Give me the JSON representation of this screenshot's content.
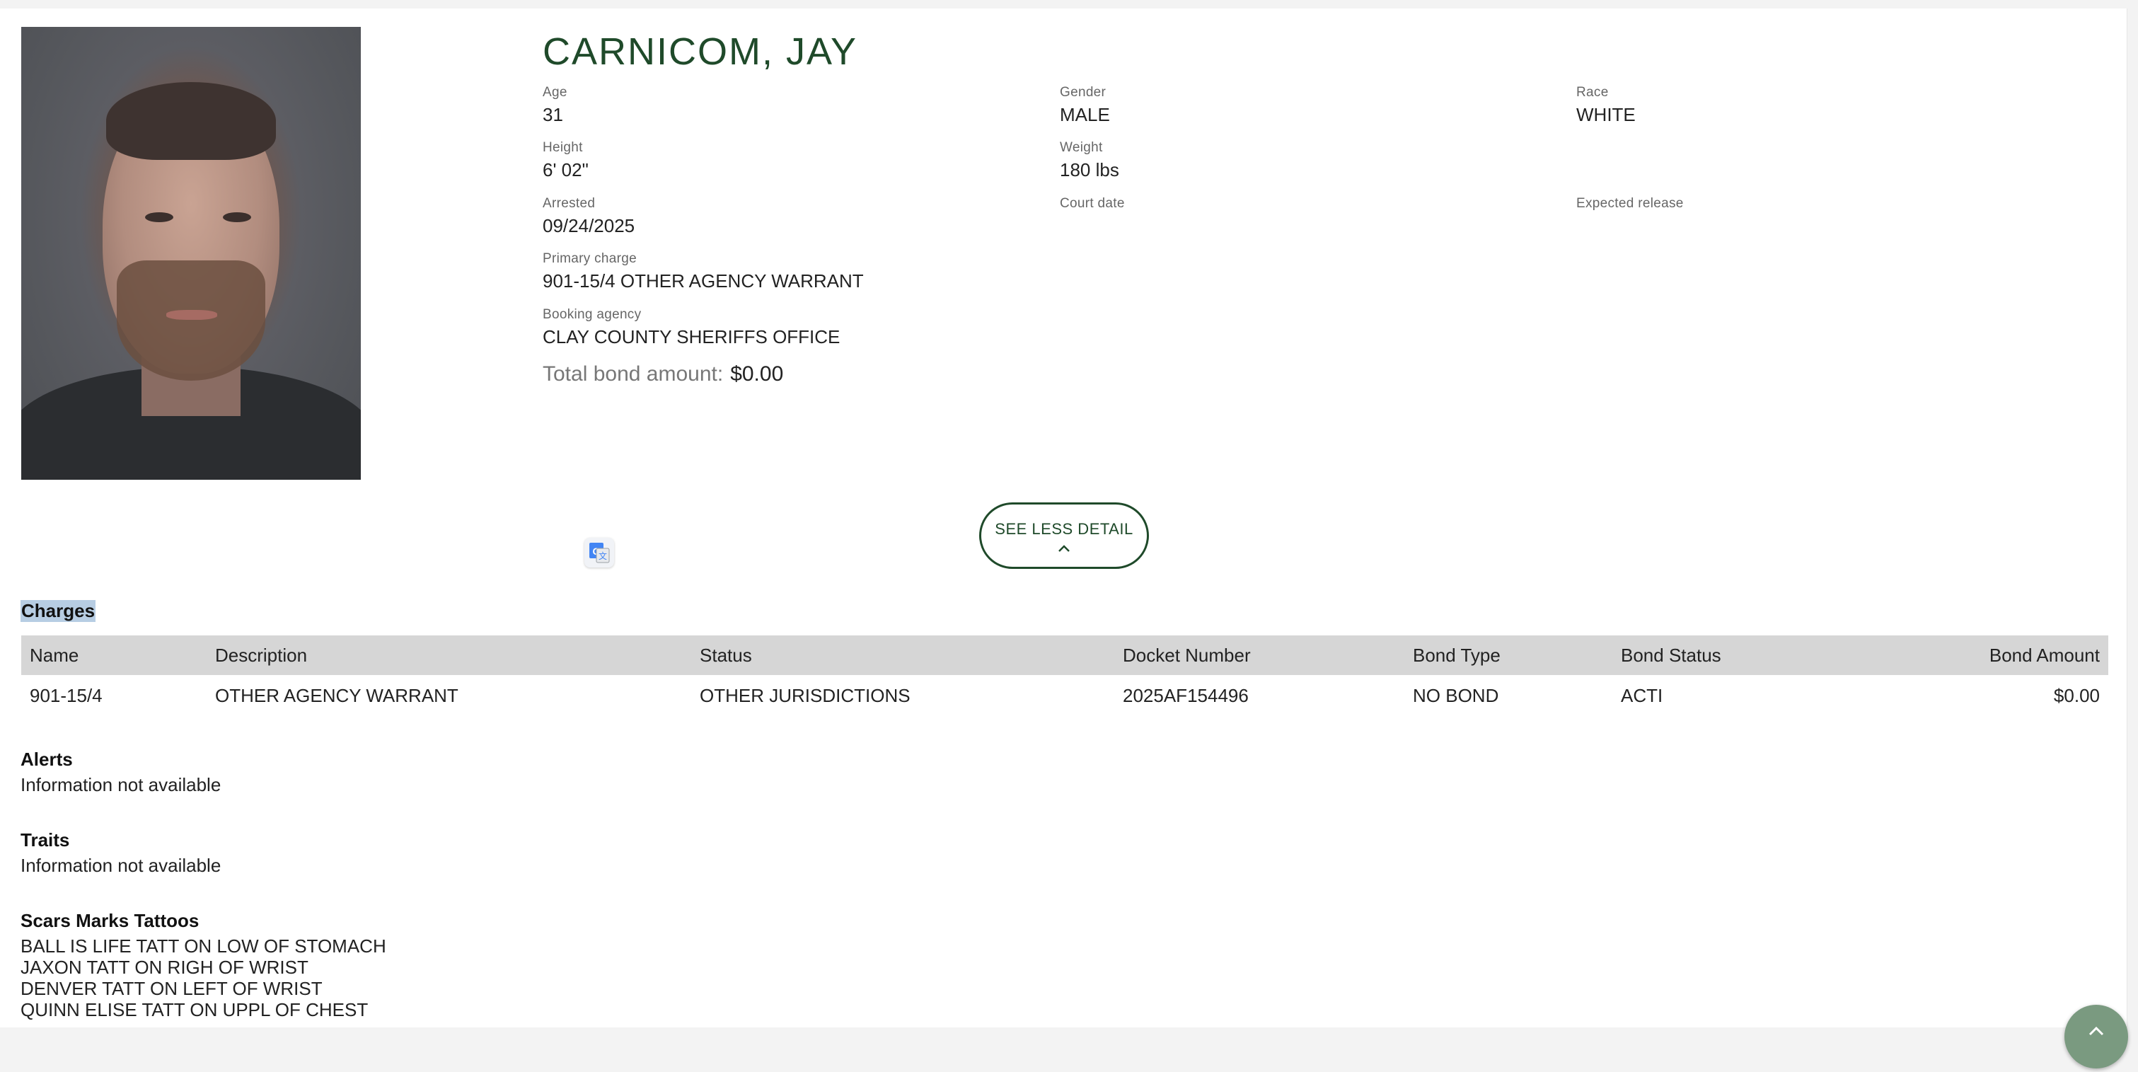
{
  "inmate": {
    "name": "CARNICOM, JAY",
    "fields": {
      "age": {
        "label": "Age",
        "value": "31"
      },
      "gender": {
        "label": "Gender",
        "value": "MALE"
      },
      "race": {
        "label": "Race",
        "value": "WHITE"
      },
      "height": {
        "label": "Height",
        "value": "6' 02\""
      },
      "weight": {
        "label": "Weight",
        "value": "180 lbs"
      },
      "arrested": {
        "label": "Arrested",
        "value": "09/24/2025"
      },
      "court_date": {
        "label": "Court date",
        "value": ""
      },
      "expected_release": {
        "label": "Expected release",
        "value": ""
      },
      "primary_charge": {
        "label": "Primary charge",
        "value": "901-15/4 OTHER AGENCY WARRANT"
      },
      "booking_agency": {
        "label": "Booking agency",
        "value": "CLAY COUNTY SHERIFFS OFFICE"
      }
    },
    "bond": {
      "label": "Total bond amount:",
      "amount": "$0.00"
    }
  },
  "actions": {
    "see_less_label": "SEE LESS DETAIL",
    "translate_icon": "google-translate-icon",
    "scroll_top_icon": "chevron-up-icon"
  },
  "charges": {
    "title": "Charges",
    "columns": [
      "Name",
      "Description",
      "Status",
      "Docket Number",
      "Bond Type",
      "Bond Status",
      "Bond Amount"
    ],
    "rows": [
      [
        "901-15/4",
        "OTHER AGENCY WARRANT",
        "OTHER JURISDICTIONS",
        "2025AF154496",
        "NO BOND",
        "ACTI",
        "$0.00"
      ]
    ]
  },
  "alerts": {
    "title": "Alerts",
    "body": "Information not available"
  },
  "traits": {
    "title": "Traits",
    "body": "Information not available"
  },
  "scars": {
    "title": "Scars Marks Tattoos",
    "lines": [
      "BALL IS LIFE TATT ON LOW OF STOMACH",
      "JAXON TATT ON RIGH OF WRIST",
      "DENVER TATT ON LEFT OF WRIST",
      "QUINN ELISE TATT ON UPPL OF CHEST"
    ]
  },
  "colors": {
    "accent_green": "#1f4a2a",
    "table_header_bg": "#d6d6d6",
    "selection_highlight": "#b7cde3"
  }
}
